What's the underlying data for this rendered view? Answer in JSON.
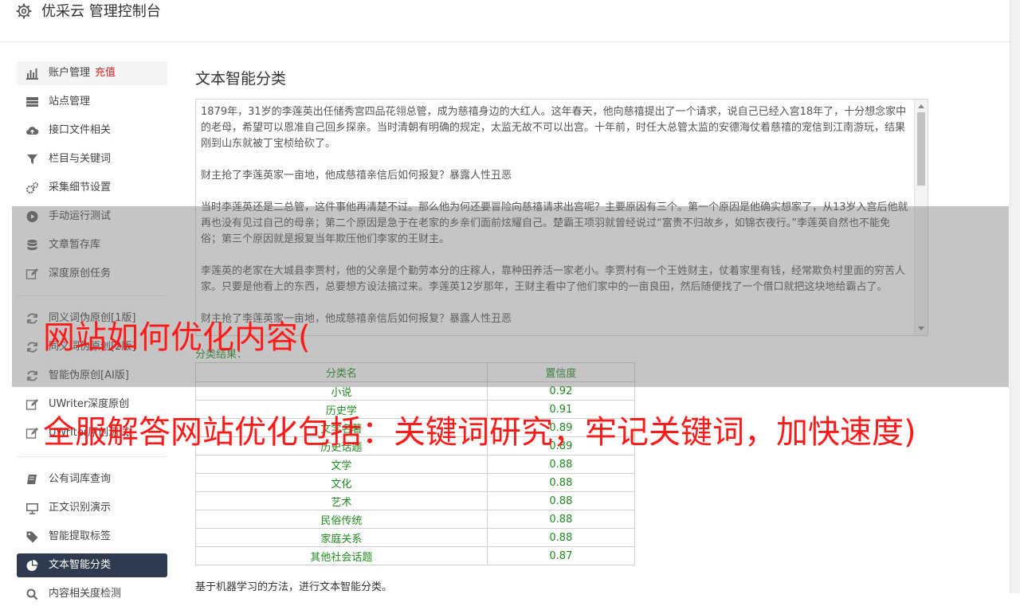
{
  "header": {
    "title": "优采云 管理控制台",
    "icon": "gear-icon"
  },
  "sidebar": {
    "items": [
      {
        "label": "账户管理",
        "extra": "充值",
        "icon": "bar-chart-icon"
      },
      {
        "label": "站点管理",
        "icon": "server-icon"
      },
      {
        "label": "接口文件相关",
        "icon": "cloud-upload-icon"
      },
      {
        "label": "栏目与关键词",
        "icon": "filter-icon"
      },
      {
        "label": "采集细节设置",
        "icon": "gears-icon"
      },
      {
        "label": "手动运行测试",
        "icon": "play-circle-icon"
      },
      {
        "label": "文章暂存库",
        "icon": "database-icon"
      },
      {
        "label": "深度原创任务",
        "icon": "edit-icon"
      },
      {
        "label": "同义词伪原创[1版]",
        "icon": "refresh-icon"
      },
      {
        "label": "同义词伪原创[2版]",
        "icon": "refresh-icon"
      },
      {
        "label": "智能伪原创[AI版]",
        "icon": "refresh-icon"
      },
      {
        "label": "UWriter深度原创",
        "icon": "edit-icon"
      },
      {
        "label": "UWriter原创测试",
        "icon": "edit-icon"
      },
      {
        "label": "公有词库查询",
        "icon": "book-icon"
      },
      {
        "label": "正文识别演示",
        "icon": "monitor-icon"
      },
      {
        "label": "智能提取标签",
        "icon": "tag-icon"
      },
      {
        "label": "文本智能分类",
        "icon": "pie-chart-icon"
      },
      {
        "label": "内容相关度检测",
        "icon": "search-icon"
      }
    ],
    "active_color": "#2e3b4e",
    "highlight_color": "#e02020"
  },
  "main": {
    "title": "文本智能分类",
    "paragraphs": [
      "1879年，31岁的李莲英出任储秀宫四品花翎总管，成为慈禧身边的大红人。这年春天，他向慈禧提出了一个请求，说自己已经入宫18年了，十分想念家中的老母，希望可以恩准自己回乡探亲。当时清朝有明确的规定，太监无故不可以出宫。十年前，时任大总管太监的安德海仗着慈禧的宠信到江南游玩，结果刚到山东就被丁宝桢给砍了。",
      "财主抢了李莲英家一亩地，他成慈禧亲信后如何报复？暴露人性丑恶",
      "当时李莲英还是二总管，这件事他再清楚不过。那么他为何还要冒险向慈禧请求出宫呢？主要原因有三个。第一个原因是他确实想家了，从13岁入宫后他就再也没有见过自己的母亲；第二个原因是急于在老家的乡亲们面前炫耀自己。楚霸王项羽就曾经说过“富贵不归故乡，如锦衣夜行。”李莲英自然也不能免俗；第三个原因就是报复当年欺压他们李家的王财主。",
      "李莲英的老家在大城县李贾村，他的父亲是个勤劳本分的庄稼人，靠种田养活一家老小。李贾村有一个王姓财主，仗着家里有钱，经常欺负村里面的穷苦人家。只要是他看上的东西，总要想方设法搞过来。李莲英12岁那年，王财主看中了他们家中的一亩良田，然后随便找了一个借口就把这块地给霸占了。",
      "财主抢了李莲英家一亩地，他成慈禧亲信后如何报复？暴露人性丑恶"
    ],
    "result_label": "分类结果：",
    "table": {
      "headers": [
        "分类名",
        "置信度"
      ],
      "rows": [
        [
          "小说",
          "0.92"
        ],
        [
          "历史学",
          "0.91"
        ],
        [
          "文学名著",
          "0.89"
        ],
        [
          "历史话题",
          "0.89"
        ],
        [
          "文学",
          "0.88"
        ],
        [
          "文化",
          "0.88"
        ],
        [
          "艺术",
          "0.88"
        ],
        [
          "民俗传统",
          "0.88"
        ],
        [
          "家庭关系",
          "0.88"
        ],
        [
          "其他社会话题",
          "0.87"
        ]
      ]
    },
    "footnote": "基于机器学习的方法，进行文本智能分类。"
  },
  "overlay": {
    "line1": "网站如何优化内容(",
    "line2": "全服解答网站优化包括：关键词研究，牢记关键词，加快速度)",
    "color": "#ff1a1a"
  }
}
